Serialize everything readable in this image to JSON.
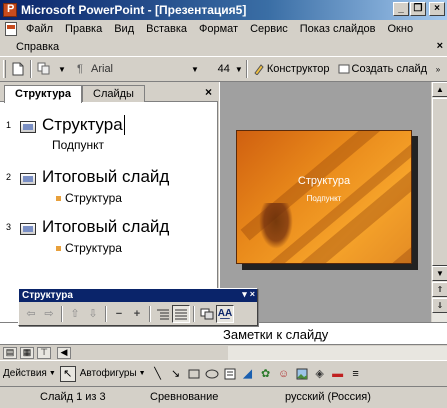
{
  "window": {
    "title": "Microsoft PowerPoint - [Презентация5]",
    "minimize": "_",
    "restore": "❐",
    "close": "×"
  },
  "menu": {
    "items": [
      "Файл",
      "Правка",
      "Вид",
      "Вставка",
      "Формат",
      "Сервис",
      "Показ слайдов",
      "Окно"
    ],
    "second_row": [
      "Справка"
    ]
  },
  "toolbar": {
    "font_name": "Arial",
    "font_size": "44",
    "designer_label": "Конструктор",
    "new_slide_label": "Создать слайд"
  },
  "tabs": {
    "outline": "Структура",
    "slides": "Слайды",
    "close": "×"
  },
  "outline": {
    "slides": [
      {
        "number": "1",
        "title": "Структура",
        "subtitle": "Подпункт"
      },
      {
        "number": "2",
        "title": "Итоговый слайд",
        "subtitle": "Структура"
      },
      {
        "number": "3",
        "title": "Итоговый слайд",
        "subtitle": "Структура"
      }
    ]
  },
  "preview": {
    "title": "Структура",
    "subtitle": "Подпункт"
  },
  "floating_toolbar": {
    "title": "Структура"
  },
  "notes": {
    "placeholder": "Заметки к слайду"
  },
  "drawing_toolbar": {
    "actions_label": "Действия",
    "autoshapes_label": "Автофигуры"
  },
  "status": {
    "slide": "Слайд 1 из 3",
    "design": "Сревнование",
    "language": "русский (Россия)"
  },
  "colors": {
    "titlebar": "#0a246a",
    "slide_orange": "#e98a1b",
    "bullet": "#e8a03c"
  }
}
